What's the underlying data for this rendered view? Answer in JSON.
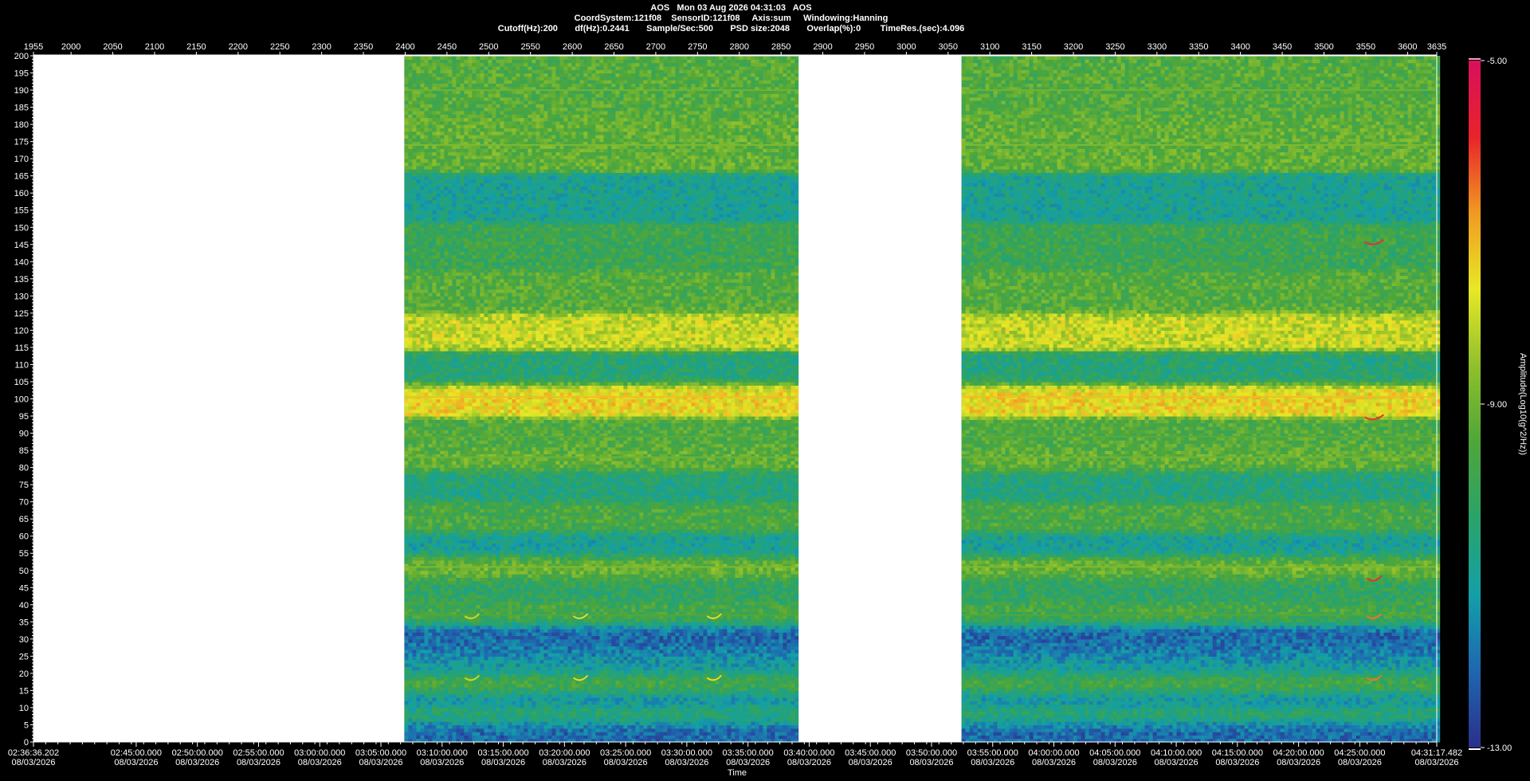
{
  "header": {
    "line1": "AOS   Mon 03 Aug 2026 04:31:03   AOS",
    "line2": "CoordSystem:121f08    SensorID:121f08     Axis:sum     Windowing:Hanning",
    "line3": "Cutoff(Hz):200       df(Hz):0.2441       Sample/Sec:500       PSD size:2048       Overlap(%):0        TimeRes.(sec):4.096"
  },
  "colors": {
    "background": "#000000",
    "no_data": "#ffffff",
    "axis": "#ffffff",
    "colormap": [
      "#2b2f8a",
      "#1f66b0",
      "#139fa8",
      "#2aa36a",
      "#4ea63a",
      "#90c02c",
      "#e8e826",
      "#f09a22",
      "#e8232a",
      "#d80f5c"
    ]
  },
  "chart_data": {
    "type": "heatmap",
    "title": "AOS   Mon 03 Aug 2026 04:31:03   AOS",
    "xlabel": "Time",
    "ylabel": "",
    "colorbar_label": "Amplitude(Log10(g^2/Hz))",
    "colorbar_range": [
      -13.0,
      -5.0
    ],
    "colorbar_ticks": [
      "-5.00",
      "-9.00",
      "-13.00"
    ],
    "top_axis_ticks": [
      "1955",
      "2000",
      "2050",
      "2100",
      "2150",
      "2200",
      "2250",
      "2300",
      "2350",
      "2400",
      "2450",
      "2500",
      "2550",
      "2600",
      "2650",
      "2700",
      "2750",
      "2800",
      "2850",
      "2900",
      "2950",
      "3000",
      "3050",
      "3100",
      "3150",
      "3200",
      "3250",
      "3300",
      "3350",
      "3400",
      "3450",
      "3500",
      "3550",
      "3600",
      "3635"
    ],
    "top_axis_range": [
      1955,
      3635
    ],
    "y_ticks": [
      0,
      5,
      10,
      15,
      20,
      25,
      30,
      35,
      40,
      45,
      50,
      55,
      60,
      65,
      70,
      75,
      80,
      85,
      90,
      95,
      100,
      105,
      110,
      115,
      120,
      125,
      130,
      135,
      140,
      145,
      150,
      155,
      160,
      165,
      170,
      175,
      180,
      185,
      190,
      195,
      200
    ],
    "ylim": [
      0,
      200
    ],
    "time_ticks": [
      {
        "time": "02:36:36.202",
        "date": "08/03/2026"
      },
      {
        "time": "02:45:00.000",
        "date": "08/03/2026"
      },
      {
        "time": "02:50:00.000",
        "date": "08/03/2026"
      },
      {
        "time": "02:55:00.000",
        "date": "08/03/2026"
      },
      {
        "time": "03:00:00.000",
        "date": "08/03/2026"
      },
      {
        "time": "03:05:00.000",
        "date": "08/03/2026"
      },
      {
        "time": "03:10:00.000",
        "date": "08/03/2026"
      },
      {
        "time": "03:15:00.000",
        "date": "08/03/2026"
      },
      {
        "time": "03:20:00.000",
        "date": "08/03/2026"
      },
      {
        "time": "03:25:00.000",
        "date": "08/03/2026"
      },
      {
        "time": "03:30:00.000",
        "date": "08/03/2026"
      },
      {
        "time": "03:35:00.000",
        "date": "08/03/2026"
      },
      {
        "time": "03:40:00.000",
        "date": "08/03/2026"
      },
      {
        "time": "03:45:00.000",
        "date": "08/03/2026"
      },
      {
        "time": "03:50:00.000",
        "date": "08/03/2026"
      },
      {
        "time": "03:55:00.000",
        "date": "08/03/2026"
      },
      {
        "time": "04:00:00.000",
        "date": "08/03/2026"
      },
      {
        "time": "04:05:00.000",
        "date": "08/03/2026"
      },
      {
        "time": "04:10:00.000",
        "date": "08/03/2026"
      },
      {
        "time": "04:15:00.000",
        "date": "08/03/2026"
      },
      {
        "time": "04:20:00.000",
        "date": "08/03/2026"
      },
      {
        "time": "04:25:00.000",
        "date": "08/03/2026"
      },
      {
        "time": "04:31:17.482",
        "date": "08/03/2026"
      }
    ],
    "time_range_seconds": [
      0,
      6881.28
    ],
    "data_segments": [
      {
        "start_index": 2399,
        "end_index": 2871
      },
      {
        "start_index": 3066,
        "end_index": 3635
      }
    ],
    "no_data_segments": [
      {
        "start_index": 1955,
        "end_index": 2399
      },
      {
        "start_index": 2871,
        "end_index": 3066
      }
    ],
    "horizontal_bands": [
      {
        "freq_hz": 1.5,
        "amplitude": -12.0
      },
      {
        "freq_hz": 4,
        "amplitude": -12.3
      },
      {
        "freq_hz": 7.5,
        "amplitude": -9.8
      },
      {
        "freq_hz": 12,
        "amplitude": -11.5
      },
      {
        "freq_hz": 17,
        "amplitude": -9.5
      },
      {
        "freq_hz": 22,
        "amplitude": -11.2
      },
      {
        "freq_hz": 27,
        "amplitude": -11.8
      },
      {
        "freq_hz": 31,
        "amplitude": -12.2
      },
      {
        "freq_hz": 37,
        "amplitude": -9.7
      },
      {
        "freq_hz": 45,
        "amplitude": -10.2
      },
      {
        "freq_hz": 51,
        "amplitude": -9.0
      },
      {
        "freq_hz": 57,
        "amplitude": -11.0
      },
      {
        "freq_hz": 65,
        "amplitude": -9.6
      },
      {
        "freq_hz": 75,
        "amplitude": -10.6
      },
      {
        "freq_hz": 83,
        "amplitude": -9.2
      },
      {
        "freq_hz": 89,
        "amplitude": -9.5
      },
      {
        "freq_hz": 100.5,
        "amplitude": -7.5
      },
      {
        "freq_hz": 108,
        "amplitude": -10.5
      },
      {
        "freq_hz": 120,
        "amplitude": -8.0
      },
      {
        "freq_hz": 130,
        "amplitude": -9.4
      },
      {
        "freq_hz": 145,
        "amplitude": -9.9
      },
      {
        "freq_hz": 158,
        "amplitude": -10.9
      },
      {
        "freq_hz": 174,
        "amplitude": -9.2
      },
      {
        "freq_hz": 190,
        "amplitude": -9.4
      }
    ],
    "events": [
      {
        "index_center": 2480,
        "freqs_hz": [
          18,
          36
        ],
        "amplitude": -8.0
      },
      {
        "index_center": 2610,
        "freqs_hz": [
          18,
          36
        ],
        "amplitude": -7.5
      },
      {
        "index_center": 2770,
        "freqs_hz": [
          18,
          36
        ],
        "amplitude": -7.5
      },
      {
        "index_center": 3560,
        "freqs_hz": [
          18,
          36,
          47,
          94,
          145
        ],
        "amplitude": -6.5
      }
    ]
  }
}
